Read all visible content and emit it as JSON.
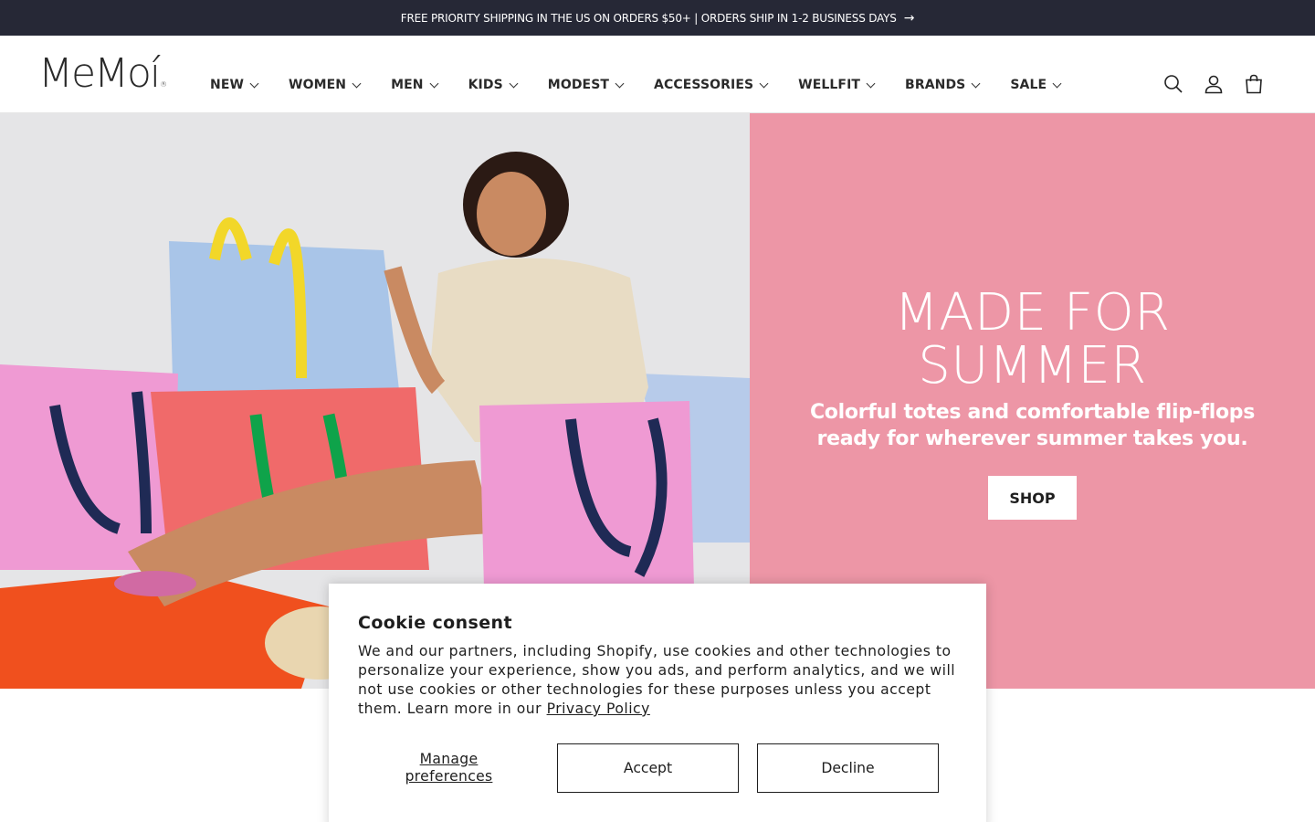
{
  "announcement": {
    "text": "FREE PRIORITY SHIPPING IN THE US ON ORDERS $50+ | ORDERS SHIP IN 1-2 BUSINESS DAYS",
    "arrow": "→"
  },
  "header": {
    "logo": "MeMoí",
    "logo_mark": "®",
    "nav": [
      "NEW",
      "WOMEN",
      "MEN",
      "KIDS",
      "MODEST",
      "ACCESSORIES",
      "WELLFIT",
      "BRANDS",
      "SALE"
    ],
    "icons": [
      "search-icon",
      "account-icon",
      "cart-icon"
    ]
  },
  "hero": {
    "title_line1": "MADE FOR",
    "title_line2": "SUMMER",
    "subtitle_line1": "Colorful totes and comfortable flip-flops",
    "subtitle_line2": "ready for wherever summer takes you.",
    "cta": "SHOP",
    "panel_color": "#ed96a6"
  },
  "cookie": {
    "title": "Cookie consent",
    "body": "We and our partners, including Shopify, use cookies and other technologies to personalize your experience, show you ads, and perform analytics, and we will not use cookies or other technologies for these purposes unless you accept them. Learn more in our",
    "link": "Privacy Policy",
    "manage_line1": "Manage",
    "manage_line2": "preferences",
    "accept": "Accept",
    "decline": "Decline"
  },
  "colors": {
    "announcement_bg": "#262836",
    "accent_pink": "#ed96a6"
  }
}
